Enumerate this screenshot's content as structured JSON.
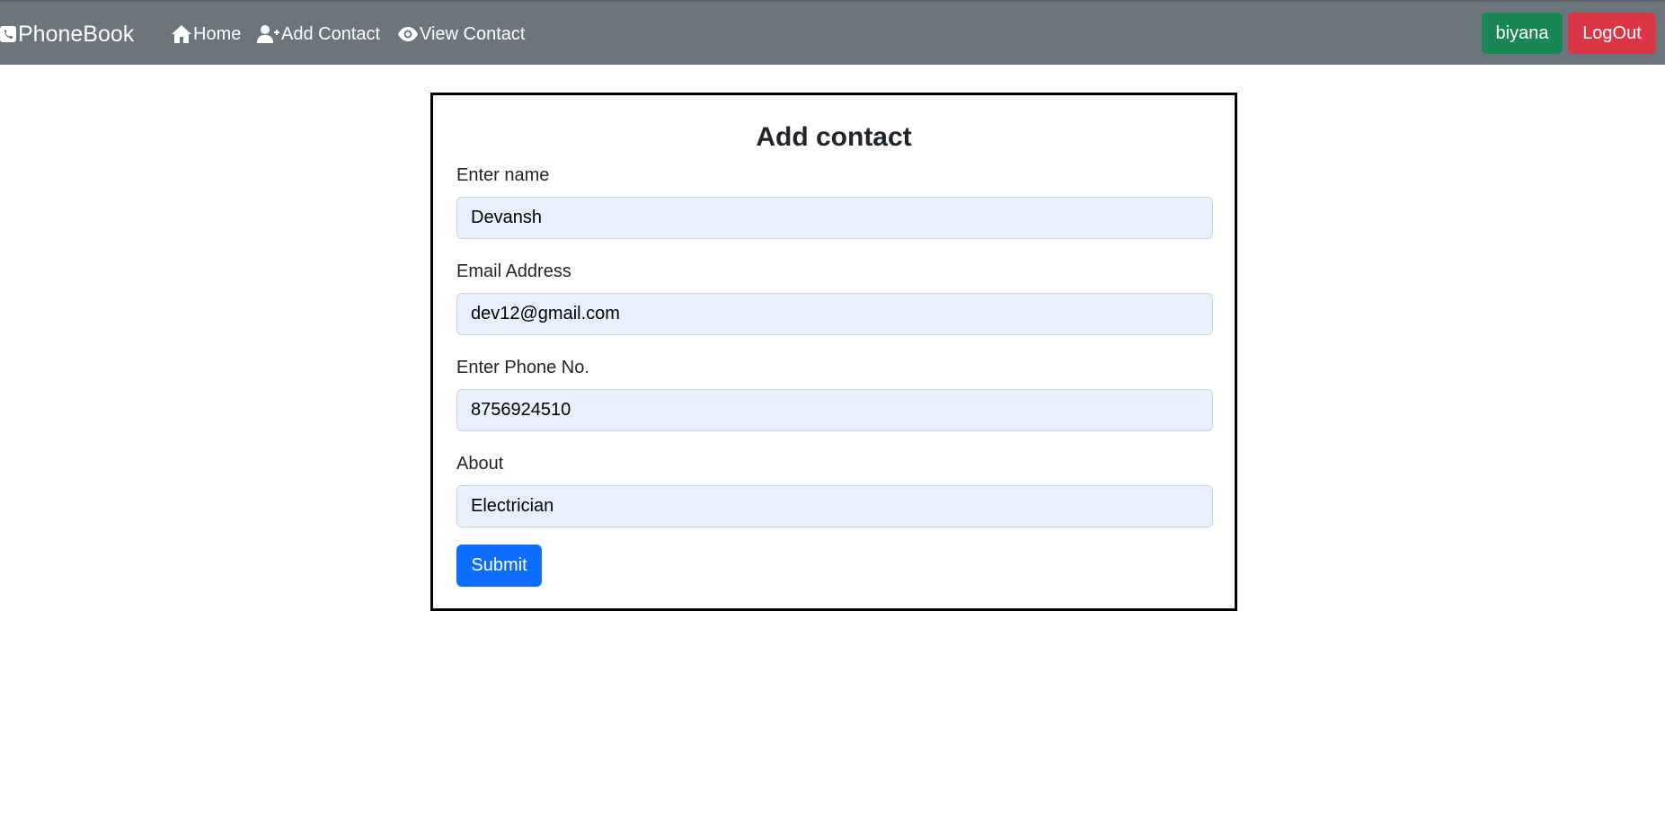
{
  "navbar": {
    "brand": "PhoneBook",
    "brand_icon": "phone-icon",
    "links": [
      {
        "label": "Home",
        "icon": "home-icon"
      },
      {
        "label": "Add Contact",
        "icon": "user-plus-icon"
      },
      {
        "label": "View Contact",
        "icon": "eye-icon"
      }
    ],
    "user_label": "biyana",
    "logout_label": "LogOut",
    "colors": {
      "bg": "#6c757d",
      "user": "#198754",
      "logout": "#dc3545"
    }
  },
  "form": {
    "title": "Add contact",
    "fields": [
      {
        "label": "Enter name",
        "value": "Devansh"
      },
      {
        "label": "Email Address",
        "value": "dev12@gmail.com"
      },
      {
        "label": "Enter Phone No.",
        "value": "8756924510"
      },
      {
        "label": "About",
        "value": "Electrician"
      }
    ],
    "submit_label": "Submit",
    "colors": {
      "input_bg": "#e8f0fe",
      "submit": "#0d6efd"
    }
  }
}
